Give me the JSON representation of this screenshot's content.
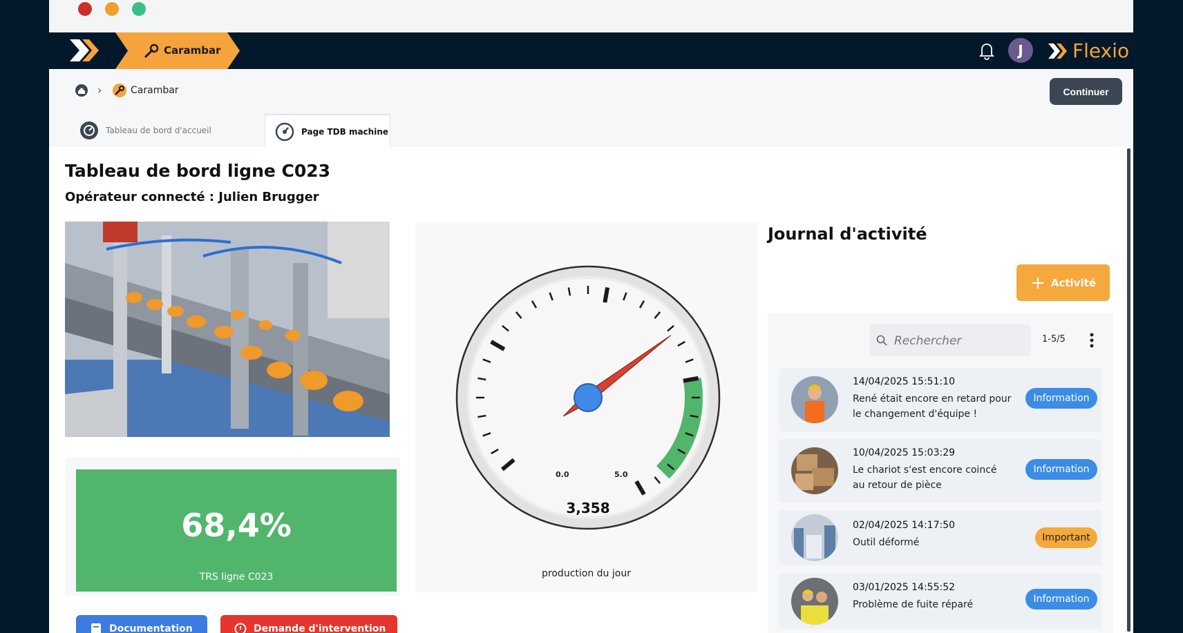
{
  "app": {
    "tab_label": "Carambar",
    "brand_name": "Flexio",
    "user_initial": "J",
    "accent_color": "#f5a33c",
    "nav_color": "#03192b"
  },
  "breadcrumb": {
    "current": "Carambar"
  },
  "header": {
    "continue_label": "Continuer"
  },
  "tabs": [
    {
      "label": "Tableau de bord d'accueil",
      "active": false,
      "icon": "dashboard-icon"
    },
    {
      "label": "Page TDB machine",
      "active": true,
      "icon": "gauge-icon"
    }
  ],
  "main": {
    "title": "Tableau de bord ligne C023",
    "subtitle": "Opérateur connecté : Julien Brugger",
    "kpi": {
      "value": "68,4%",
      "label": "TRS ligne C023",
      "color": "#52b56c"
    },
    "buttons": {
      "documentation": "Documentation",
      "intervention": "Demande d'intervention"
    },
    "gauge": {
      "value": "3,358",
      "scale_label_low": "0.0",
      "scale_label_high": "5.0",
      "caption": "production du jour"
    }
  },
  "journal": {
    "title": "Journal d'activité",
    "add_label": "Activité",
    "search_placeholder": "Rechercher",
    "pager": "1-5/5",
    "entries": [
      {
        "date": "14/04/2025 15:51:10",
        "text": "René était encore en retard pour le changement d'équipe !",
        "badge": "Information",
        "badge_type": "info"
      },
      {
        "date": "10/04/2025 15:03:29",
        "text": "Le chariot s'est encore coincé au retour de pièce",
        "badge": "Information",
        "badge_type": "info"
      },
      {
        "date": "02/04/2025 14:17:50",
        "text": "Outil déformé",
        "badge": "Important",
        "badge_type": "important"
      },
      {
        "date": "03/01/2025 14:55:52",
        "text": "Problème de fuite réparé",
        "badge": "Information",
        "badge_type": "info"
      }
    ]
  }
}
